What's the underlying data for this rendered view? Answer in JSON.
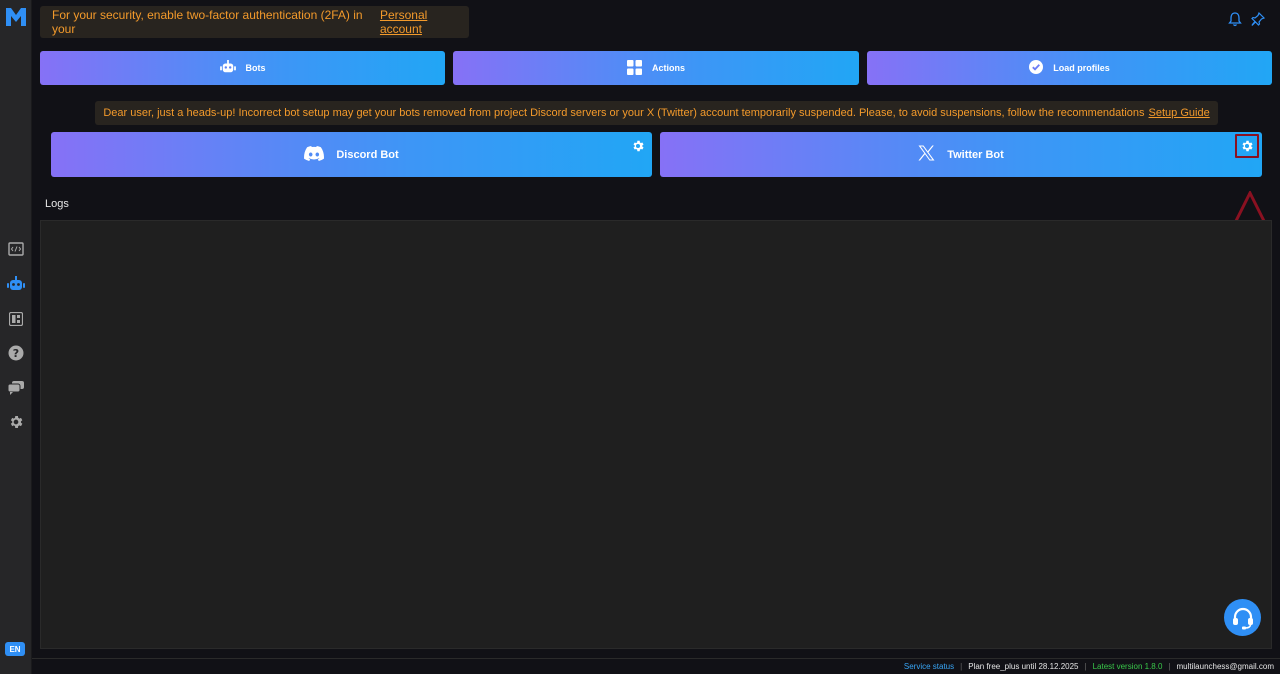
{
  "sidebar": {
    "logo": "M",
    "items": [
      {
        "name": "code-icon"
      },
      {
        "name": "robot-icon",
        "active": true
      },
      {
        "name": "dashboard-icon"
      },
      {
        "name": "help-icon"
      },
      {
        "name": "chat-icon"
      },
      {
        "name": "gear-icon"
      }
    ],
    "language": "EN"
  },
  "notice": {
    "text": "For your security, enable two-factor authentication (2FA) in your",
    "link": "Personal account"
  },
  "nav": {
    "bots": "Bots",
    "actions": "Actions",
    "load_profiles": "Load profiles"
  },
  "warning": {
    "text": "Dear user, just a heads-up! Incorrect bot setup may get your bots removed from project Discord servers or your X (Twitter) account temporarily suspended. Please, to avoid suspensions, follow the recommendations",
    "link": "Setup Guide"
  },
  "bots": {
    "discord": "Discord Bot",
    "twitter": "Twitter Bot"
  },
  "logs": {
    "label": "Logs"
  },
  "footer": {
    "service_status": "Service status",
    "plan": "Plan free_plus  until 28.12.2025",
    "version": "Latest version 1.8.0",
    "email": "multilaunchess@gmail.com"
  },
  "colors": {
    "accent": "#2f8ff5",
    "warning_text": "#f39a2b",
    "highlight": "#8a1121"
  }
}
